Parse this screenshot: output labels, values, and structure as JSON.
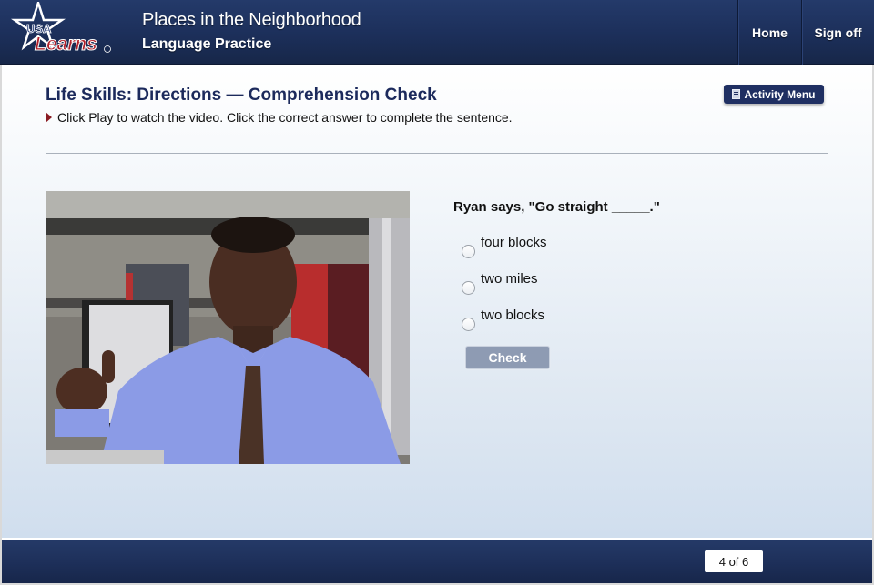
{
  "header": {
    "logo_text_top": "USA",
    "logo_text_bottom": "Learns",
    "title": "Places in the Neighborhood",
    "subtitle": "Language Practice",
    "nav": [
      {
        "label": "Home"
      },
      {
        "label": "Sign off"
      }
    ]
  },
  "main": {
    "title": "Life Skills: Directions — Comprehension Check",
    "instruction": "Click Play to watch the video. Click the correct answer to complete the sentence.",
    "activity_menu_label": "Activity Menu",
    "video": {
      "description": "Ryan in a cafe kitchen pointing with his thumb"
    },
    "question": "Ryan says, \"Go straight _____.\"",
    "options": [
      {
        "label": "four blocks",
        "selected": false
      },
      {
        "label": "two miles",
        "selected": false
      },
      {
        "label": "two blocks",
        "selected": false
      }
    ],
    "check_label": "Check"
  },
  "footer": {
    "page_indicator": "4 of 6"
  },
  "colors": {
    "brand_navy": "#1c2f5a",
    "title_navy": "#1c2a5c",
    "arrow_red": "#8a1c22",
    "check_button": "#8e9bb3",
    "logo_red": "#b0202a"
  }
}
